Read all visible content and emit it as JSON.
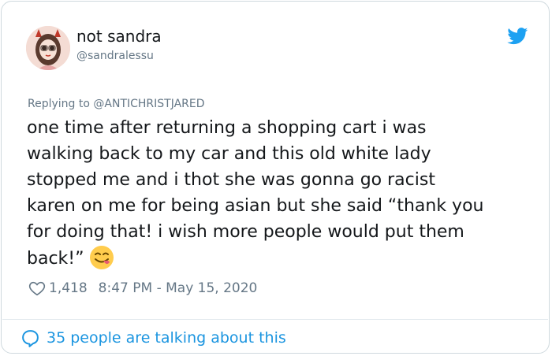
{
  "tweet": {
    "author_name": "not sandra",
    "author_handle": "@sandralessu",
    "replying_prefix": "Replying to ",
    "replying_to": "@ANTICHRISTJARED",
    "text": "one time after returning a shopping cart i was\nwalking back to my car and this old white lady\nstopped me and i thot she was gonna go racist\nkaren on me for being asian but she said “thank you\nfor doing that! i wish more people would put them\nback!”",
    "emoji": "face-savoring-food-emoji",
    "like_count": "1,418",
    "timestamp": "8:47 PM - May 15, 2020"
  },
  "footer": {
    "talking_text": "35 people are talking about this"
  },
  "icons": {
    "brand": "twitter-bird-icon",
    "like": "heart-outline-icon",
    "talk": "speech-bubble-icon"
  },
  "colors": {
    "brand_blue": "#1da1f2",
    "link_blue": "#1b95e0",
    "text": "#14171a",
    "muted": "#657786",
    "border": "#cfd9de"
  }
}
